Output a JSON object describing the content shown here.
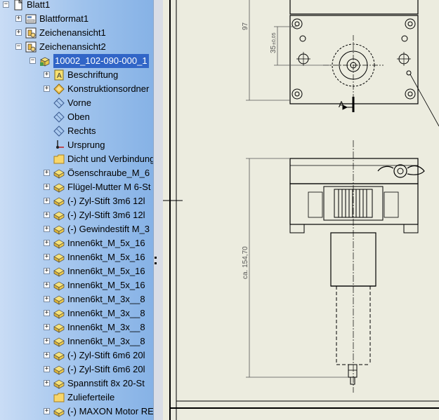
{
  "tree": {
    "items": [
      {
        "label": "Blatt1",
        "icon": "sheet-icon",
        "expander": "−",
        "level": 0
      },
      {
        "label": "Blattformat1",
        "icon": "sheet-format-icon",
        "expander": "+",
        "level": 1
      },
      {
        "label": "Zeichenansicht1",
        "icon": "drawing-view-icon",
        "expander": "+",
        "level": 1
      },
      {
        "label": "Zeichenansicht2",
        "icon": "drawing-view-icon",
        "expander": "−",
        "level": 1
      },
      {
        "label": "10002_102-090-000_1",
        "icon": "assembly-icon",
        "expander": "−",
        "level": 2,
        "selected": true
      },
      {
        "label": "Beschriftung",
        "icon": "annotation-icon",
        "expander": "+",
        "level": 3
      },
      {
        "label": "Konstruktionsordner",
        "icon": "design-folder-icon",
        "expander": "+",
        "level": 3
      },
      {
        "label": "Vorne",
        "icon": "plane-icon",
        "expander": "",
        "level": 3
      },
      {
        "label": "Oben",
        "icon": "plane-icon",
        "expander": "",
        "level": 3
      },
      {
        "label": "Rechts",
        "icon": "plane-icon",
        "expander": "",
        "level": 3
      },
      {
        "label": "Ursprung",
        "icon": "origin-icon",
        "expander": "",
        "level": 3
      },
      {
        "label": "Dicht und Verbindungen",
        "icon": "folder-icon",
        "expander": "",
        "level": 3
      },
      {
        "label": "Ösenschraube_M_6",
        "icon": "part-icon",
        "expander": "+",
        "level": 3
      },
      {
        "label": "Flügel-Mutter M 6-St",
        "icon": "part-icon",
        "expander": "+",
        "level": 3
      },
      {
        "label": "(-) Zyl-Stift 3m6 12l",
        "icon": "part-icon",
        "expander": "+",
        "level": 3
      },
      {
        "label": "(-) Zyl-Stift 3m6 12l",
        "icon": "part-icon",
        "expander": "+",
        "level": 3
      },
      {
        "label": "(-) Gewindestift M_3",
        "icon": "part-icon",
        "expander": "+",
        "level": 3
      },
      {
        "label": "Innen6kt_M_5x_16",
        "icon": "part-icon",
        "expander": "+",
        "level": 3
      },
      {
        "label": "Innen6kt_M_5x_16",
        "icon": "part-icon",
        "expander": "+",
        "level": 3
      },
      {
        "label": "Innen6kt_M_5x_16",
        "icon": "part-icon",
        "expander": "+",
        "level": 3
      },
      {
        "label": "Innen6kt_M_5x_16",
        "icon": "part-icon",
        "expander": "+",
        "level": 3
      },
      {
        "label": "Innen6kt_M_3x__8",
        "icon": "part-icon",
        "expander": "+",
        "level": 3
      },
      {
        "label": "Innen6kt_M_3x__8",
        "icon": "part-icon",
        "expander": "+",
        "level": 3
      },
      {
        "label": "Innen6kt_M_3x__8",
        "icon": "part-icon",
        "expander": "+",
        "level": 3
      },
      {
        "label": "Innen6kt_M_3x__8",
        "icon": "part-icon",
        "expander": "+",
        "level": 3
      },
      {
        "label": "(-) Zyl-Stift 6m6 20l",
        "icon": "part-icon",
        "expander": "+",
        "level": 3
      },
      {
        "label": "(-) Zyl-Stift 6m6 20l",
        "icon": "part-icon",
        "expander": "+",
        "level": 3
      },
      {
        "label": "Spannstift  8x 20-St",
        "icon": "part-icon",
        "expander": "+",
        "level": 3
      },
      {
        "label": "Zulieferteile",
        "icon": "folder-icon",
        "expander": "",
        "level": 3
      },
      {
        "label": "(-) MAXON Motor RE",
        "icon": "part-icon",
        "expander": "+",
        "level": 3
      }
    ]
  },
  "drawing": {
    "dim_97": "97",
    "dim_35": "35",
    "dim_35_tol": "±0,05",
    "dim_ca": "ca. 154,70",
    "section_label": "A"
  },
  "colors": {
    "selection": "#3165c7",
    "sheet": "#ececdf",
    "line": "#000000",
    "dim": "#555555"
  }
}
